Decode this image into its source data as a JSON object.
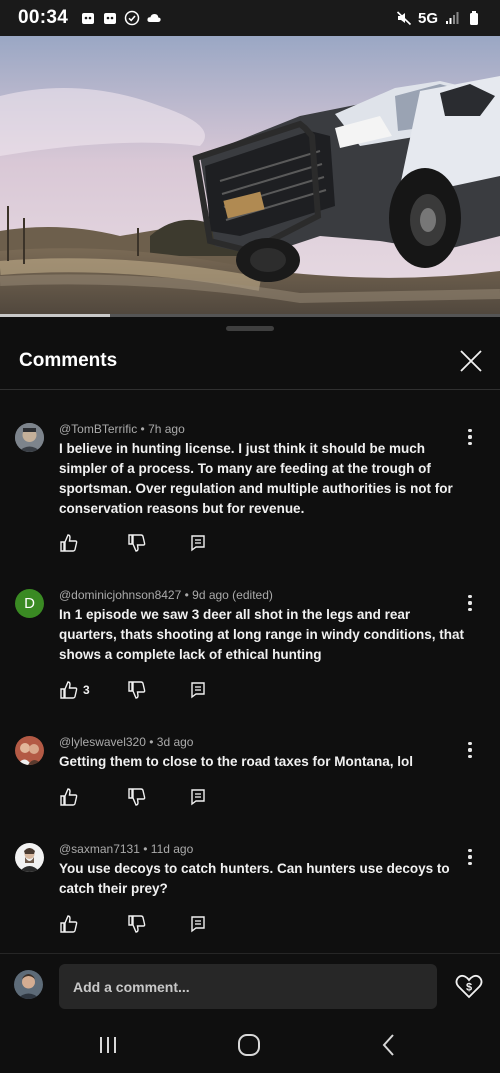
{
  "status_bar": {
    "time": "00:34",
    "network": "5G",
    "left_icons": [
      "notification-icon",
      "notification-icon",
      "check-circle-icon",
      "cloud-icon"
    ],
    "right_icons": [
      "mute-icon",
      "signal-icon",
      "battery-icon"
    ]
  },
  "video": {
    "progress_fraction": 0.22,
    "progress_color": "#c9c9c9"
  },
  "sheet": {
    "title": "Comments"
  },
  "comments": [
    {
      "author": "@TomBTerrific",
      "time": "7h ago",
      "text": "I believe in hunting license. I just think it should be much simpler of a process. To many are feeding at the trough of sportsman. Over regulation and multiple authorities is not for conservation reasons but for revenue.",
      "likes": "",
      "avatar_type": "photo"
    },
    {
      "author": "@dominicjohnson8427",
      "time": "9d ago (edited)",
      "text": "In 1 episode we saw 3 deer all shot in the legs and rear quarters, thats shooting at long range in windy conditions, that shows a complete lack of ethical hunting",
      "likes": "3",
      "avatar_type": "letter",
      "avatar_letter": "D",
      "avatar_color": "#3a8a23"
    },
    {
      "author": "@lyleswavel320",
      "time": "3d ago",
      "text": "Getting them to close to the road taxes for Montana, lol",
      "likes": "",
      "avatar_type": "photo"
    },
    {
      "author": "@saxman7131",
      "time": "11d ago",
      "text": "You use decoys to catch hunters. Can hunters use decoys to catch their prey?",
      "likes": "",
      "avatar_type": "photo"
    }
  ],
  "composer": {
    "placeholder": "Add a comment...",
    "super_thanks_symbol": "$"
  },
  "navbar": {
    "icons": [
      "recent-apps-icon",
      "home-icon",
      "back-icon"
    ]
  },
  "colors": {
    "background": "#0f0f0f",
    "input_background": "#272727",
    "meta_text": "#aaaaaa"
  }
}
